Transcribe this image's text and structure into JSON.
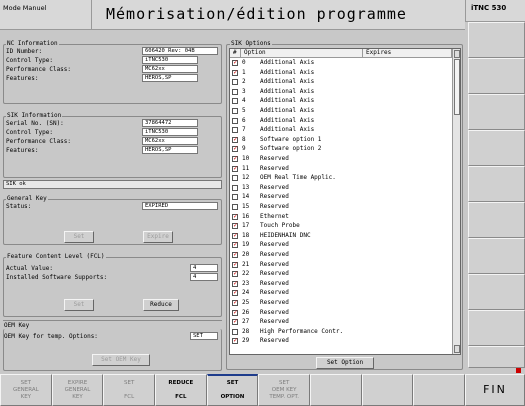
{
  "header": {
    "mode": "Mode Manuel",
    "title": "Mémorisation/édition programme",
    "brand": "iTNC 530"
  },
  "nc_info": {
    "legend": "NC Information",
    "id_label": "ID Number:",
    "id_value": "606420 Rev: 04B",
    "control_label": "Control Type:",
    "control_value": "iTNC530",
    "perf_label": "Performance Class:",
    "perf_value": "MC62xx",
    "features_label": "Features:",
    "features_value": "HEROS,SP"
  },
  "sik_info": {
    "legend": "SIK Information",
    "serial_label": "Serial No. (SN):",
    "serial_value": "37864472",
    "control_label": "Control Type:",
    "control_value": "iTNC530",
    "perf_label": "Performance Class:",
    "perf_value": "MC62xx",
    "features_label": "Features:",
    "features_value": "HEROS,SP"
  },
  "sik_status": "SIK ok",
  "general_key": {
    "legend": "General Key",
    "status_label": "Status:",
    "status_value": "EXPIRED",
    "set_label": "Set",
    "expire_label": "Expire"
  },
  "fcl": {
    "legend": "Feature Content Level (FCL)",
    "actual_label": "Actual Value:",
    "actual_value": "4",
    "installed_label": "Installed Software Supports:",
    "installed_value": "4",
    "set_label": "Set",
    "reduce_label": "Reduce"
  },
  "oem_key": {
    "legend": "OEM Key",
    "temp_label": "OEM Key for temp. Options:",
    "temp_value": "SET",
    "button_label": "Set OEM Key"
  },
  "sik_options": {
    "legend": "SIK Options",
    "col_num": "#",
    "col_option": "Option",
    "col_expires": "Expires",
    "set_option_label": "Set Option",
    "rows": [
      {
        "checked": true,
        "num": "0",
        "name": "Additional Axis"
      },
      {
        "checked": true,
        "num": "1",
        "name": "Additional Axis"
      },
      {
        "checked": false,
        "num": "2",
        "name": "Additional Axis"
      },
      {
        "checked": false,
        "num": "3",
        "name": "Additional Axis"
      },
      {
        "checked": false,
        "num": "4",
        "name": "Additional Axis"
      },
      {
        "checked": false,
        "num": "5",
        "name": "Additional Axis"
      },
      {
        "checked": false,
        "num": "6",
        "name": "Additional Axis"
      },
      {
        "checked": false,
        "num": "7",
        "name": "Additional Axis"
      },
      {
        "checked": true,
        "num": "8",
        "name": "Software option 1"
      },
      {
        "checked": true,
        "num": "9",
        "name": "Software option 2"
      },
      {
        "checked": true,
        "num": "10",
        "name": "Reserved"
      },
      {
        "checked": true,
        "num": "11",
        "name": "Reserved"
      },
      {
        "checked": false,
        "num": "12",
        "name": "OEM Real Time Applic."
      },
      {
        "checked": false,
        "num": "13",
        "name": "Reserved"
      },
      {
        "checked": false,
        "num": "14",
        "name": "Reserved"
      },
      {
        "checked": false,
        "num": "15",
        "name": "Reserved"
      },
      {
        "checked": true,
        "num": "16",
        "name": "Ethernet"
      },
      {
        "checked": true,
        "num": "17",
        "name": "Touch Probe"
      },
      {
        "checked": true,
        "num": "18",
        "name": "HEIDENHAIN DNC"
      },
      {
        "checked": true,
        "num": "19",
        "name": "Reserved"
      },
      {
        "checked": true,
        "num": "20",
        "name": "Reserved"
      },
      {
        "checked": true,
        "num": "21",
        "name": "Reserved"
      },
      {
        "checked": true,
        "num": "22",
        "name": "Reserved"
      },
      {
        "checked": true,
        "num": "23",
        "name": "Reserved"
      },
      {
        "checked": true,
        "num": "24",
        "name": "Reserved"
      },
      {
        "checked": true,
        "num": "25",
        "name": "Reserved"
      },
      {
        "checked": true,
        "num": "26",
        "name": "Reserved"
      },
      {
        "checked": true,
        "num": "27",
        "name": "Reserved"
      },
      {
        "checked": false,
        "num": "28",
        "name": "High Performance Contr."
      },
      {
        "checked": true,
        "num": "29",
        "name": "Reserved"
      }
    ]
  },
  "softkeys": [
    {
      "line1": "SET",
      "line2": "GENERAL",
      "line3": "KEY",
      "enabled": false
    },
    {
      "line1": "EXPIRE",
      "line2": "GENERAL",
      "line3": "KEY",
      "enabled": false
    },
    {
      "line1": "SET",
      "line2": "",
      "line3": "FCL",
      "enabled": false
    },
    {
      "line1": "REDUCE",
      "line2": "",
      "line3": "FCL",
      "enabled": true
    },
    {
      "line1": "SET",
      "line2": "",
      "line3": "OPTION",
      "enabled": true
    },
    {
      "line1": "SET",
      "line2": "OEM KEY",
      "line3": "TEMP. OPT.",
      "enabled": false
    },
    {
      "line1": "",
      "line2": "",
      "line3": "",
      "enabled": false
    },
    {
      "line1": "",
      "line2": "",
      "line3": "",
      "enabled": false
    },
    {
      "line1": "",
      "line2": "",
      "line3": "",
      "enabled": false
    }
  ],
  "fin_label": "FIN",
  "colors": {
    "accent": "#1e3c8c",
    "check": "#cc0000",
    "panel": "#c8c8c8"
  }
}
